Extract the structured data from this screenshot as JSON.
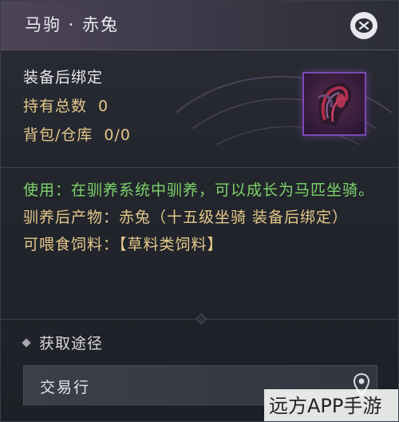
{
  "header": {
    "title": "马驹 · 赤兔"
  },
  "info": {
    "bind_type": "装备后绑定",
    "owned_label": "持有总数",
    "owned_value": "0",
    "storage_label": "背包/仓库",
    "storage_value": "0/0"
  },
  "description": {
    "usage": "使用：在驯养系统中驯养，可以成长为马匹坐骑。",
    "product": "驯养后产物：赤兔（十五级坐骑 装备后绑定）",
    "feed": "可喂食饲料：【草料类饲料】"
  },
  "source": {
    "title": "获取途径",
    "items": [
      {
        "label": "交易行"
      }
    ]
  },
  "watermark": {
    "text": "远方APP手游网"
  },
  "icons": {
    "close": "close-icon",
    "location": "location-pin-icon",
    "item": "horse-item-icon"
  },
  "colors": {
    "accent_gold": "#e5c88a",
    "usage_green": "#7dd36a",
    "item_border_purple": "#7a4bb0"
  }
}
